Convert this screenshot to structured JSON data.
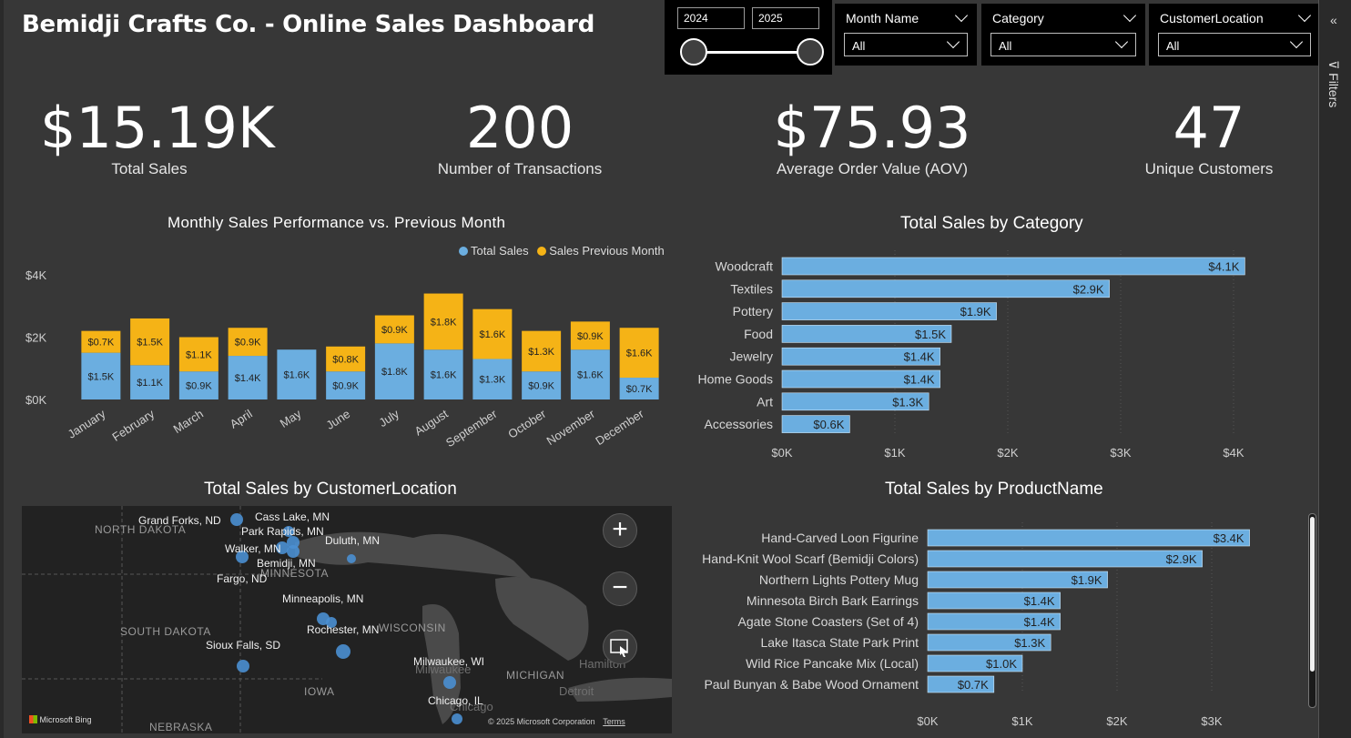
{
  "title": "Bemidji Crafts Co. - Online Sales Dashboard",
  "year_slicer": {
    "start": "2024",
    "end": "2025"
  },
  "slicers": [
    {
      "label": "Month Name",
      "value": "All"
    },
    {
      "label": "Category",
      "value": "All"
    },
    {
      "label": "CustomerLocation",
      "value": "All"
    }
  ],
  "filters_pane": {
    "label": "Filters"
  },
  "kpis": [
    {
      "value": "$15.19K",
      "label": "Total Sales"
    },
    {
      "value": "200",
      "label": "Number of Transactions"
    },
    {
      "value": "$75.93",
      "label": "Average Order Value (AOV)"
    },
    {
      "value": "47",
      "label": "Unique Customers"
    }
  ],
  "colors": {
    "blue": "#6baee0",
    "gold": "#f5b316",
    "background": "#373737"
  },
  "chart_data": [
    {
      "type": "bar",
      "stacked": true,
      "title": "Monthly Sales Performance vs. Previous Month",
      "categories": [
        "January",
        "February",
        "March",
        "April",
        "May",
        "June",
        "July",
        "August",
        "September",
        "October",
        "November",
        "December"
      ],
      "series": [
        {
          "name": "Total Sales",
          "color": "#6baee0",
          "values": [
            1.5,
            1.1,
            0.9,
            1.4,
            1.6,
            0.9,
            1.8,
            1.6,
            1.3,
            0.9,
            1.6,
            0.7
          ],
          "labels": [
            "$1.5K",
            "$1.1K",
            "$0.9K",
            "$1.4K",
            "$1.6K",
            "$0.9K",
            "$1.8K",
            "$1.6K",
            "$1.3K",
            "$0.9K",
            "$1.6K",
            "$0.7K"
          ]
        },
        {
          "name": "Sales Previous Month",
          "color": "#f5b316",
          "values": [
            0.7,
            1.5,
            1.1,
            0.9,
            0,
            0.8,
            0.9,
            1.8,
            1.6,
            1.3,
            0.9,
            1.6
          ],
          "labels": [
            "$0.7K",
            "$1.5K",
            "$1.1K",
            "$0.9K",
            "",
            "$0.8K",
            "$0.9K",
            "$1.8K",
            "$1.6K",
            "$1.3K",
            "$0.9K",
            "$1.6K"
          ]
        }
      ],
      "yticks": [
        "$0K",
        "$2K",
        "$4K"
      ],
      "ylim": [
        0,
        4
      ],
      "legend": "top-right"
    },
    {
      "type": "bar",
      "orientation": "horizontal",
      "title": "Total Sales by Category",
      "categories": [
        "Woodcraft",
        "Textiles",
        "Pottery",
        "Food",
        "Jewelry",
        "Home Goods",
        "Art",
        "Accessories"
      ],
      "values": [
        4.1,
        2.9,
        1.9,
        1.5,
        1.4,
        1.4,
        1.3,
        0.6
      ],
      "labels": [
        "$4.1K",
        "$2.9K",
        "$1.9K",
        "$1.5K",
        "$1.4K",
        "$1.4K",
        "$1.3K",
        "$0.6K"
      ],
      "xticks": [
        "$0K",
        "$1K",
        "$2K",
        "$3K",
        "$4K"
      ],
      "xlim": [
        0,
        4
      ]
    },
    {
      "type": "bar",
      "orientation": "horizontal",
      "title": "Total Sales by ProductName",
      "categories": [
        "Hand-Carved Loon Figurine",
        "Hand-Knit Wool Scarf (Bemidji Colors)",
        "Northern Lights Pottery Mug",
        "Minnesota Birch Bark Earrings",
        "Agate Stone Coasters (Set of 4)",
        "Lake Itasca State Park Print",
        "Wild Rice Pancake Mix (Local)",
        "Paul Bunyan & Babe Wood Ornament"
      ],
      "values": [
        3.4,
        2.9,
        1.9,
        1.4,
        1.4,
        1.3,
        1.0,
        0.7
      ],
      "labels": [
        "$3.4K",
        "$2.9K",
        "$1.9K",
        "$1.4K",
        "$1.4K",
        "$1.3K",
        "$1.0K",
        "$0.7K"
      ],
      "xticks": [
        "$0K",
        "$1K",
        "$2K",
        "$3K"
      ],
      "xlim": [
        0,
        3
      ]
    }
  ],
  "map": {
    "title": "Total Sales by CustomerLocation",
    "cities": [
      "Grand Forks, ND",
      "Cass Lake, MN",
      "Park Rapids, MN",
      "Duluth, MN",
      "Walker, MN",
      "Bemidji, MN",
      "Fargo, ND",
      "Minneapolis, MN",
      "Rochester, MN",
      "Sioux Falls, SD",
      "Milwaukee, WI",
      "Chicago, IL"
    ],
    "regions": [
      "NORTH DAKOTA",
      "MINNESOTA",
      "SOUTH DAKOTA",
      "WISCONSIN",
      "MICHIGAN",
      "IOWA",
      "NEBRASKA"
    ],
    "background_places": [
      "Milwaukee",
      "Hamilton",
      "Detroit",
      "Chicago"
    ],
    "zoom_in": "+",
    "zoom_out": "−",
    "credit": "Microsoft Bing",
    "copyright": "© 2025 Microsoft Corporation",
    "terms": "Terms"
  }
}
